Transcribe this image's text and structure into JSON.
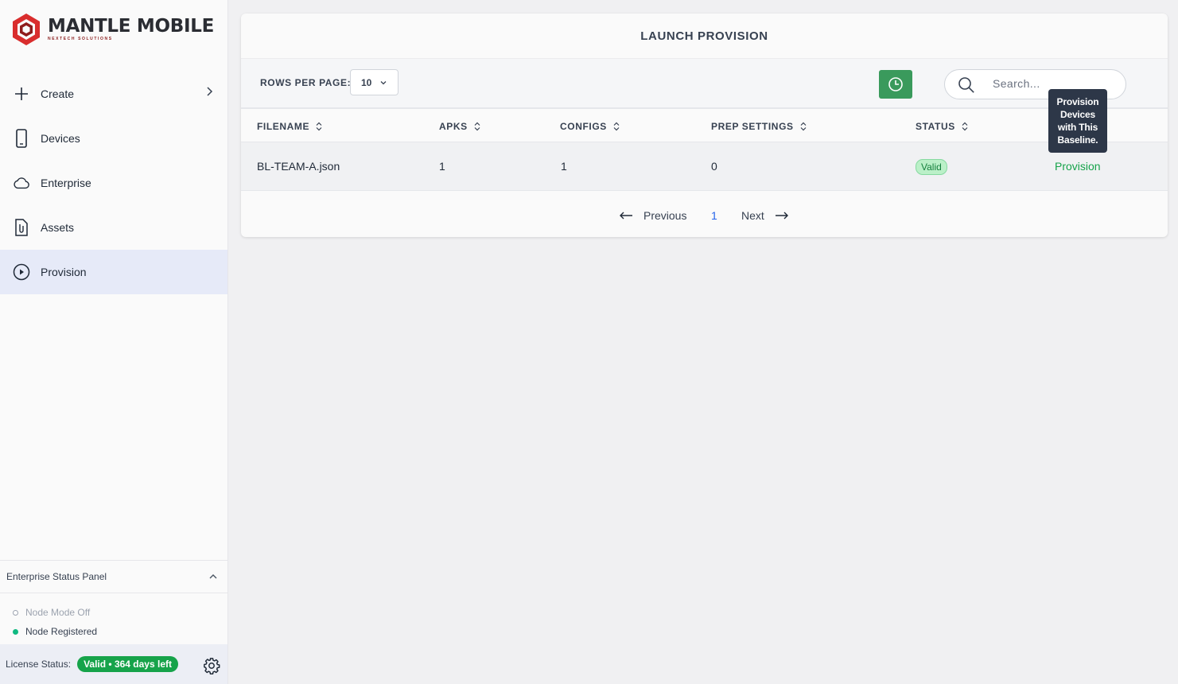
{
  "brand": {
    "title": "MANTLE MOBILE",
    "subtitle": "NEXTECH SOLUTIONS",
    "color": "#d92d2d"
  },
  "sidebar": {
    "items": [
      {
        "label": "Create",
        "icon": "plus-icon",
        "has_chevron": true
      },
      {
        "label": "Devices",
        "icon": "phone-icon"
      },
      {
        "label": "Enterprise",
        "icon": "cloud-icon"
      },
      {
        "label": "Assets",
        "icon": "file-clip-icon"
      },
      {
        "label": "Provision",
        "icon": "play-circle-icon",
        "active": true
      }
    ]
  },
  "status_panel": {
    "title": "Enterprise Status Panel",
    "items": [
      {
        "label": "Node Mode Off",
        "state": "off"
      },
      {
        "label": "Node Registered",
        "state": "on"
      }
    ]
  },
  "license": {
    "label": "License Status:",
    "badge": "Valid • 364 days left"
  },
  "main": {
    "title": "LAUNCH PROVISION",
    "rows_per_page_label": "ROWS PER PAGE:",
    "rows_per_page_value": "10",
    "search_placeholder": "Search...",
    "columns": [
      "FILENAME",
      "APKS",
      "CONFIGS",
      "PREP SETTINGS",
      "STATUS"
    ],
    "rows": [
      {
        "filename": "BL-TEAM-A.json",
        "apks": "1",
        "configs": "1",
        "prep_settings": "0",
        "status": "Valid",
        "action": "Provision"
      }
    ],
    "pagination": {
      "previous": "Previous",
      "page": "1",
      "next": "Next"
    },
    "tooltip": "Provision Devices with This Baseline."
  }
}
